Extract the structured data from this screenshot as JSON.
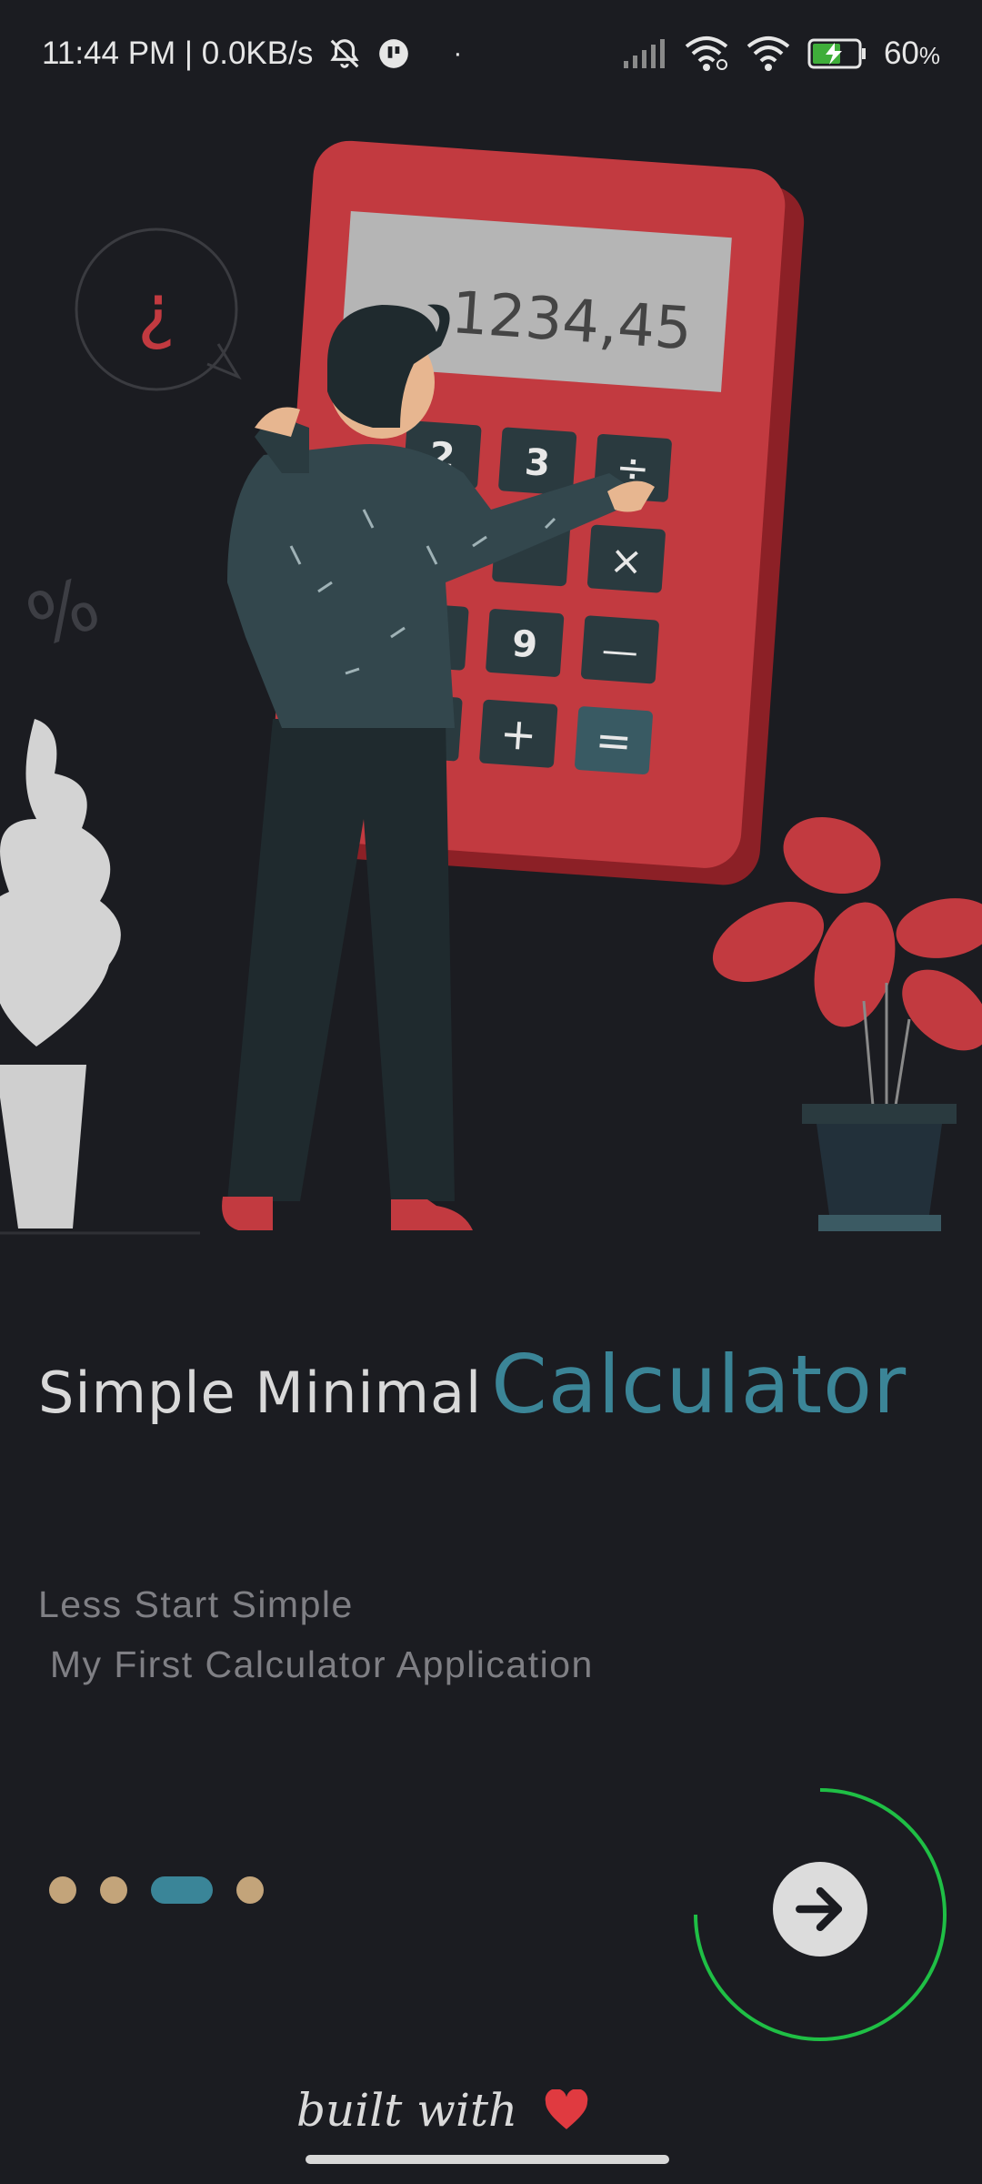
{
  "status_bar": {
    "time_speed": "11:44 PM | 0.0KB/s",
    "dot": "·",
    "battery_percent": "60",
    "battery_unit": "%"
  },
  "illustration": {
    "display_value": "1234,45",
    "question_glyph": "¿",
    "percent_glyph": "%",
    "keys": [
      "2",
      "3",
      "÷",
      "×",
      "9",
      "—",
      "+",
      "="
    ]
  },
  "headline": {
    "light": "Simple Minimal",
    "accent": "Calculator"
  },
  "subtitle": {
    "line1": "Less Start Simple",
    "line2": " My First Calculator Application"
  },
  "pager": {
    "count": 4,
    "active_index": 2
  },
  "footer": {
    "text": "built with"
  },
  "colors": {
    "background": "#1b1c21",
    "accent": "#3b8597",
    "dot": "#c3a47a",
    "progress_ring": "#1fbf45",
    "calculator_red": "#c23a40",
    "heart": "#e03a40"
  }
}
